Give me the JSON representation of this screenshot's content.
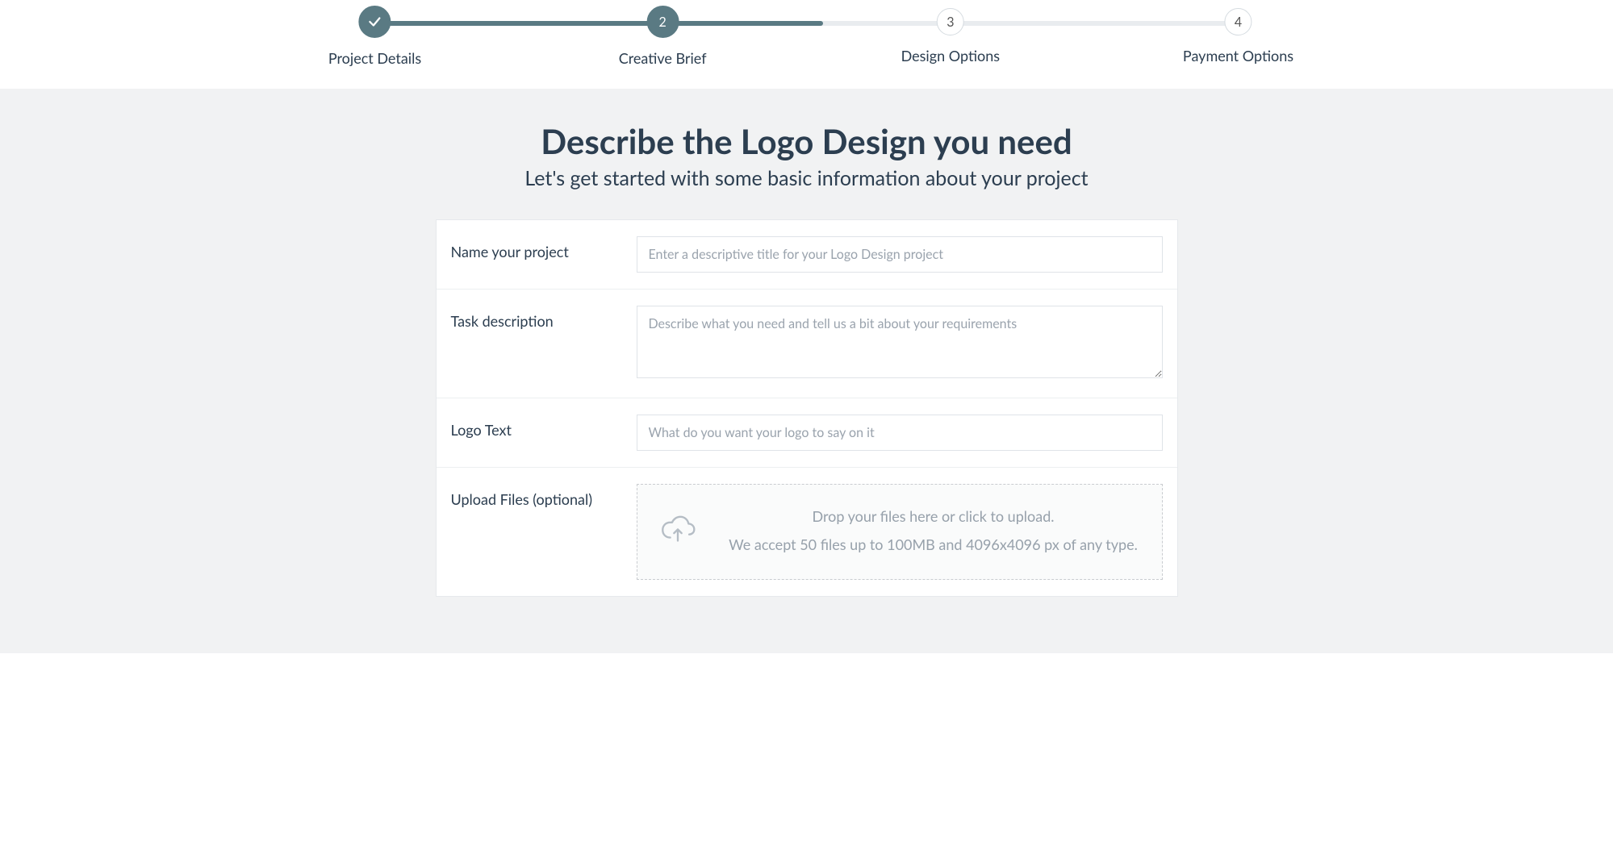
{
  "stepper": {
    "steps": [
      {
        "label": "Project Details",
        "state": "done"
      },
      {
        "label": "Creative Brief",
        "state": "active",
        "num": "2"
      },
      {
        "label": "Design Options",
        "state": "pending",
        "num": "3"
      },
      {
        "label": "Payment Options",
        "state": "pending",
        "num": "4"
      }
    ]
  },
  "page": {
    "heading": "Describe the Logo Design you need",
    "subheading": "Let's get started with some basic information about your project"
  },
  "form": {
    "project_name": {
      "label": "Name your project",
      "placeholder": "Enter a descriptive title for your Logo Design project",
      "value": ""
    },
    "task_description": {
      "label": "Task description",
      "placeholder": "Describe what you need and tell us a bit about your requirements",
      "value": ""
    },
    "logo_text": {
      "label": "Logo Text",
      "placeholder": "What do you want your logo to say on it",
      "value": ""
    },
    "upload": {
      "label": "Upload Files (optional)",
      "line1": "Drop your files here or click to upload.",
      "line2": "We accept 50 files up to 100MB and 4096x4096 px of any type."
    }
  }
}
